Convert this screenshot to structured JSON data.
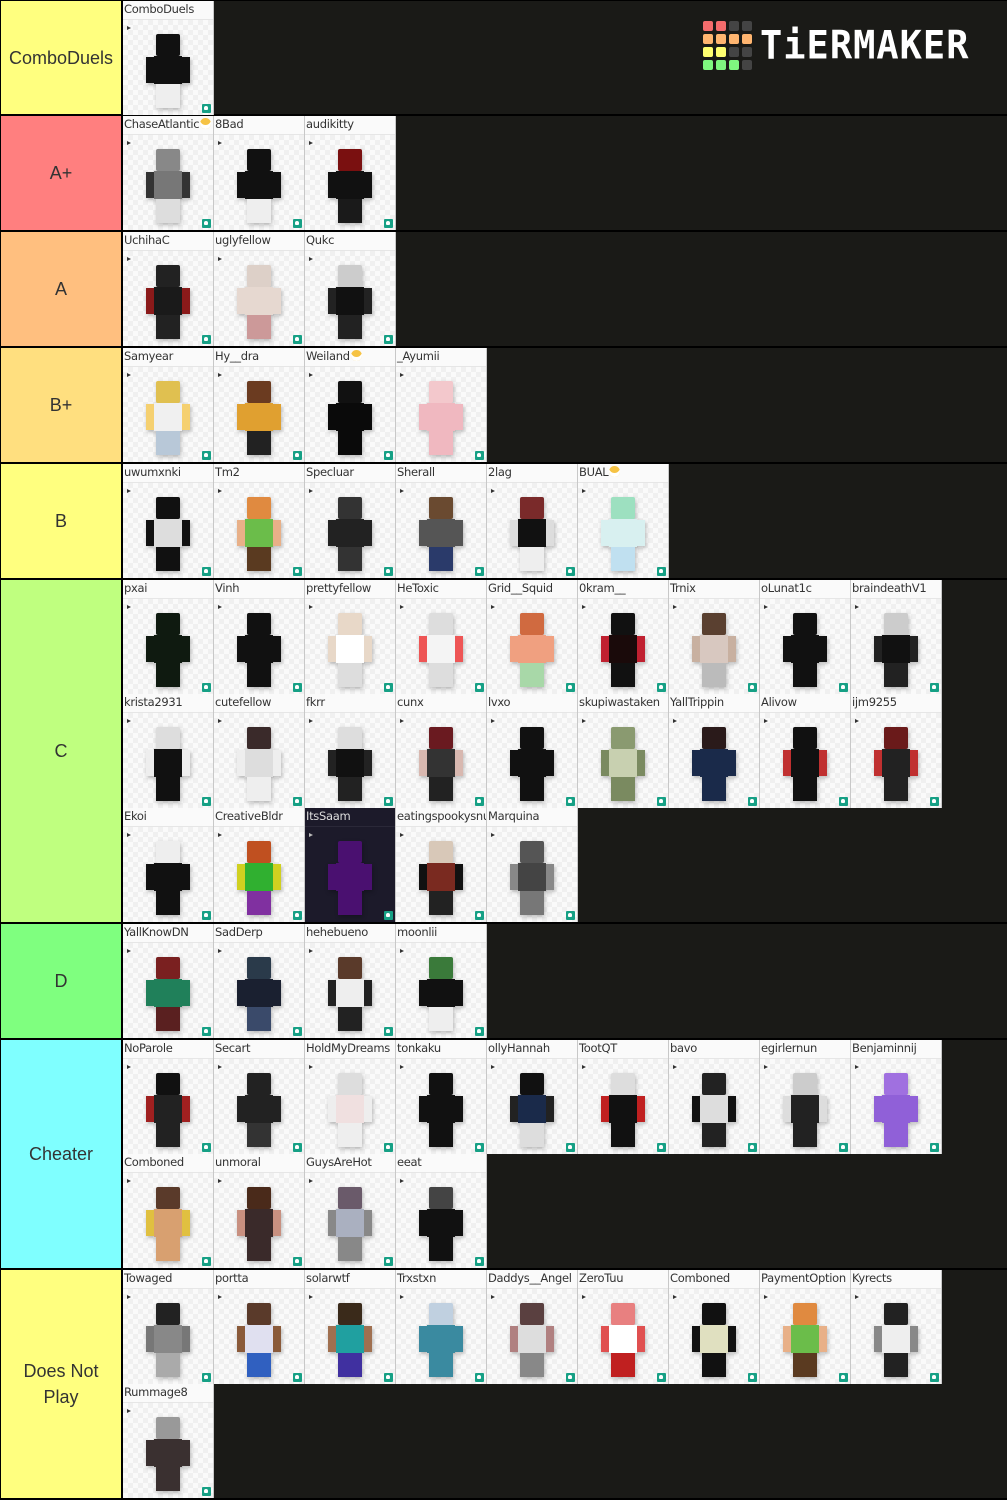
{
  "logo": {
    "text": "TiERMAKER",
    "grid_colors": [
      "#f36c6c",
      "#f36c6c",
      "#444444",
      "#444444",
      "#ffb570",
      "#ffb570",
      "#ffb570",
      "#ffb570",
      "#ffff70",
      "#ffff70",
      "#444444",
      "#444444",
      "#7ff77f",
      "#7ff77f",
      "#7ff77f",
      "#444444"
    ]
  },
  "tiers": [
    {
      "label": "ComboDuels",
      "color": "#ffff7f",
      "items": [
        {
          "name": "ComboDuels",
          "skin": [
            "#111",
            "#111",
            "#111",
            "#eee"
          ]
        }
      ]
    },
    {
      "label": "A+",
      "color": "#ff7f7f",
      "items": [
        {
          "name": "ChaseAtlantic",
          "emoji": true,
          "skin": [
            "#888",
            "#777",
            "#333",
            "#ddd"
          ]
        },
        {
          "name": "8Bad",
          "skin": [
            "#111",
            "#111",
            "#111",
            "#eee"
          ]
        },
        {
          "name": "audikitty",
          "skin": [
            "#7a1010",
            "#111",
            "#111",
            "#1a1a1a"
          ]
        }
      ]
    },
    {
      "label": "A",
      "color": "#ffbf7f",
      "items": [
        {
          "name": "UchihaC",
          "skin": [
            "#222",
            "#1a1a1a",
            "#8b1a1a",
            "#222"
          ]
        },
        {
          "name": "uglyfellow",
          "skin": [
            "#ddd0c8",
            "#e6d8d0",
            "#e6d8d0",
            "#c99"
          ]
        },
        {
          "name": "Qukc",
          "skin": [
            "#ccc",
            "#111",
            "#222",
            "#222"
          ]
        }
      ]
    },
    {
      "label": "B+",
      "color": "#ffdf7f",
      "items": [
        {
          "name": "Samyear",
          "skin": [
            "#e0c050",
            "#f0f0f0",
            "#f5d070",
            "#b8c8d8"
          ]
        },
        {
          "name": "Hy__dra",
          "skin": [
            "#6b3b20",
            "#e0a030",
            "#e0a030",
            "#222"
          ]
        },
        {
          "name": "Weiland",
          "emoji": true,
          "skin": [
            "#111",
            "#0a0a0a",
            "#0a0a0a",
            "#0a0a0a"
          ]
        },
        {
          "name": "_Ayumii",
          "skin": [
            "#f3c8cc",
            "#f0b8c0",
            "#f0b8c0",
            "#f0b8c0"
          ]
        }
      ]
    },
    {
      "label": "B",
      "color": "#ffff7f",
      "items": [
        {
          "name": "uwumxnki",
          "skin": [
            "#111",
            "#ddd",
            "#111",
            "#111"
          ]
        },
        {
          "name": "Tm2",
          "skin": [
            "#e08a40",
            "#6bbd4a",
            "#e8b088",
            "#5a3a20"
          ]
        },
        {
          "name": "Specluar",
          "skin": [
            "#333",
            "#222",
            "#222",
            "#333"
          ]
        },
        {
          "name": "Sherall",
          "skin": [
            "#6a4a30",
            "#555",
            "#555",
            "#2a3a6a"
          ]
        },
        {
          "name": "2lag",
          "skin": [
            "#7a2a2a",
            "#111",
            "#ddd",
            "#eee"
          ]
        },
        {
          "name": "BUAL",
          "emoji": true,
          "skin": [
            "#9de0c0",
            "#d8f0f0",
            "#d8f0f0",
            "#c0e0f0"
          ]
        }
      ]
    },
    {
      "label": "C",
      "color": "#bfff7f",
      "items": [
        {
          "name": "pxai",
          "skin": [
            "#0f1a10",
            "#0f1a10",
            "#0f1a10",
            "#0f1a10"
          ]
        },
        {
          "name": "Vinh",
          "skin": [
            "#111",
            "#111",
            "#111",
            "#111"
          ]
        },
        {
          "name": "prettyfellow",
          "skin": [
            "#e8d8c8",
            "#fff",
            "#e8d8c8",
            "#ddd"
          ]
        },
        {
          "name": "HeToxic",
          "skin": [
            "#ddd",
            "#f4f4f4",
            "#e55",
            "#ddd"
          ]
        },
        {
          "name": "Grid__Squid",
          "skin": [
            "#d06a40",
            "#f0a080",
            "#f0a080",
            "#a8d8a8"
          ]
        },
        {
          "name": "0kram__",
          "skin": [
            "#111",
            "#1a0a0a",
            "#c02030",
            "#111"
          ]
        },
        {
          "name": "Trnix",
          "skin": [
            "#5a4030",
            "#d8c8c0",
            "#c8b0a0",
            "#bbb"
          ]
        },
        {
          "name": "oLunat1c",
          "skin": [
            "#111",
            "#111",
            "#111",
            "#111"
          ]
        },
        {
          "name": "braindeathV1",
          "skin": [
            "#ccc",
            "#111",
            "#222",
            "#222"
          ]
        },
        {
          "name": "krista2931",
          "skin": [
            "#ddd",
            "#111",
            "#eee",
            "#111"
          ]
        },
        {
          "name": "cutefellow",
          "skin": [
            "#3a2a2a",
            "#ddd",
            "#eee",
            "#eee"
          ]
        },
        {
          "name": "fkrr",
          "skin": [
            "#ddd",
            "#111",
            "#222",
            "#222"
          ]
        },
        {
          "name": "cunx",
          "skin": [
            "#6a1a20",
            "#333",
            "#d8b8b0",
            "#222"
          ]
        },
        {
          "name": "lvxo",
          "skin": [
            "#111",
            "#111",
            "#111",
            "#111"
          ]
        },
        {
          "name": "skupiwastaken",
          "skin": [
            "#8a9a70",
            "#c8d0b0",
            "#7a8a60",
            "#7a8a60"
          ]
        },
        {
          "name": "YallTrippin",
          "skin": [
            "#2a1a1a",
            "#1a2a4a",
            "#1a2a4a",
            "#1a2a4a"
          ]
        },
        {
          "name": "Alivow",
          "skin": [
            "#111",
            "#111",
            "#c03030",
            "#111"
          ]
        },
        {
          "name": "ijm9255",
          "skin": [
            "#6a1a1a",
            "#222",
            "#c03030",
            "#222"
          ]
        },
        {
          "name": "Ekoi",
          "skin": [
            "#eee",
            "#111",
            "#111",
            "#111"
          ]
        },
        {
          "name": "CreativeBldr",
          "skin": [
            "#c05020",
            "#30b030",
            "#d0d020",
            "#8030a0"
          ]
        },
        {
          "name": "ItsSaam",
          "dark": true,
          "skin": [
            "#4a1070",
            "#4a1070",
            "#4a1070",
            "#4a1070"
          ]
        },
        {
          "name": "eatingspookysnu",
          "skin": [
            "#d8c8b8",
            "#7a2a20",
            "#111",
            "#222"
          ]
        },
        {
          "name": "Marquina",
          "skin": [
            "#555",
            "#444",
            "#888",
            "#777"
          ]
        }
      ]
    },
    {
      "label": "D",
      "color": "#7fff7f",
      "items": [
        {
          "name": "YallKnowDN",
          "skin": [
            "#7a2020",
            "#20805a",
            "#20805a",
            "#5a2020"
          ]
        },
        {
          "name": "SadDerp",
          "skin": [
            "#2a3a4a",
            "#1a2030",
            "#1a2030",
            "#3a4a6a"
          ]
        },
        {
          "name": "hehebueno",
          "skin": [
            "#5a3a2a",
            "#eee",
            "#222",
            "#222"
          ]
        },
        {
          "name": "moonlii",
          "skin": [
            "#3a7a3a",
            "#111",
            "#111",
            "#eee"
          ]
        }
      ]
    },
    {
      "label": "Cheater",
      "color": "#7fffff",
      "items": [
        {
          "name": "NoParole",
          "skin": [
            "#111",
            "#222",
            "#a02020",
            "#222"
          ]
        },
        {
          "name": "Secart",
          "skin": [
            "#222",
            "#222",
            "#222",
            "#333"
          ]
        },
        {
          "name": "HoldMyDreams",
          "skin": [
            "#ddd",
            "#f0e0e0",
            "#eee",
            "#eee"
          ]
        },
        {
          "name": "tonkaku",
          "skin": [
            "#111",
            "#111",
            "#111",
            "#111"
          ]
        },
        {
          "name": "ollyHannah",
          "skin": [
            "#111",
            "#1a2a4a",
            "#222",
            "#ddd"
          ]
        },
        {
          "name": "TootQT",
          "skin": [
            "#ddd",
            "#111",
            "#c02020",
            "#111"
          ]
        },
        {
          "name": "bavo",
          "skin": [
            "#222",
            "#ddd",
            "#111",
            "#222"
          ]
        },
        {
          "name": "egirlernun",
          "skin": [
            "#ccc",
            "#222",
            "#ddd",
            "#222"
          ]
        },
        {
          "name": "Benjaminnij",
          "skin": [
            "#a070e0",
            "#9060d8",
            "#9060d8",
            "#9060d8"
          ]
        },
        {
          "name": "Comboned",
          "skin": [
            "#5a3a2a",
            "#d8a070",
            "#e0c040",
            "#d8a070"
          ]
        },
        {
          "name": "unmoral",
          "skin": [
            "#4a2a1a",
            "#3a2a2a",
            "#c89080",
            "#3a2a2a"
          ]
        },
        {
          "name": "GuysAreHot",
          "skin": [
            "#6a5a6a",
            "#aab0c0",
            "#888",
            "#888"
          ]
        },
        {
          "name": "eeat",
          "skin": [
            "#444",
            "#111",
            "#111",
            "#111"
          ]
        }
      ]
    },
    {
      "label": "Does Not Play",
      "color": "#ffff7f",
      "items": [
        {
          "name": "Towaged",
          "skin": [
            "#222",
            "#888",
            "#777",
            "#aaa"
          ]
        },
        {
          "name": "portta",
          "skin": [
            "#5a3a2a",
            "#e0e0f0",
            "#8a5a3a",
            "#3060c0"
          ]
        },
        {
          "name": "solarwtf",
          "skin": [
            "#3a2a1a",
            "#20a0a0",
            "#a07050",
            "#4030a0"
          ]
        },
        {
          "name": "Trxstxn",
          "skin": [
            "#c0d0e0",
            "#3a8aa0",
            "#3a8aa0",
            "#3a8aa0"
          ]
        },
        {
          "name": "Daddys__Angel",
          "skin": [
            "#5a4040",
            "#ddd",
            "#b08080",
            "#888"
          ]
        },
        {
          "name": "ZeroTuu",
          "skin": [
            "#e88080",
            "#fff",
            "#e05050",
            "#c02020"
          ]
        },
        {
          "name": "Comboned",
          "skin": [
            "#111",
            "#e0e0c0",
            "#111",
            "#111"
          ]
        },
        {
          "name": "PaymentOption",
          "skin": [
            "#e08a40",
            "#6bbd4a",
            "#e8b088",
            "#5a3a20"
          ]
        },
        {
          "name": "Kyrects",
          "skin": [
            "#222",
            "#eee",
            "#888",
            "#222"
          ]
        },
        {
          "name": "Rummage8",
          "skin": [
            "#999",
            "#3a3030",
            "#3a3030",
            "#3a3030"
          ]
        }
      ]
    }
  ]
}
